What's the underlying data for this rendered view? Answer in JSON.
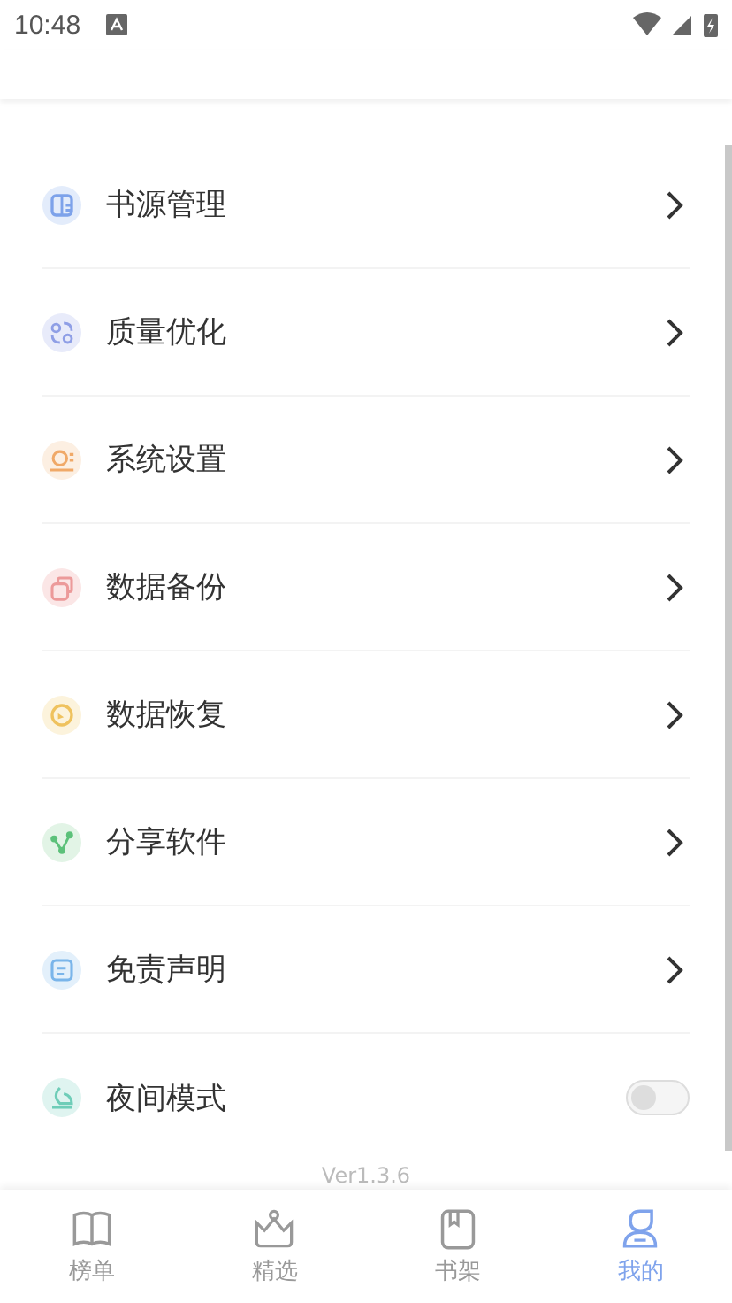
{
  "status_bar": {
    "time": "10:48"
  },
  "menu": [
    {
      "kind": "link",
      "label": "书源管理",
      "color": "#e3ecfb"
    },
    {
      "kind": "link",
      "label": "质量优化",
      "color": "#e8ebfa"
    },
    {
      "kind": "link",
      "label": "系统设置",
      "color": "#fcefe2"
    },
    {
      "kind": "link",
      "label": "数据备份",
      "color": "#fbe6e6"
    },
    {
      "kind": "link",
      "label": "数据恢复",
      "color": "#fcf3dc"
    },
    {
      "kind": "link",
      "label": "分享软件",
      "color": "#e2f4e6"
    },
    {
      "kind": "link",
      "label": "免责声明",
      "color": "#e3f0fb"
    },
    {
      "kind": "toggle",
      "label": "夜间模式",
      "color": "#dff4f0",
      "on": false
    }
  ],
  "version": "Ver1.3.6",
  "tabs": [
    {
      "label": "榜单",
      "selected": false
    },
    {
      "label": "精选",
      "selected": false
    },
    {
      "label": "书架",
      "selected": false
    },
    {
      "label": "我的",
      "selected": true
    }
  ]
}
